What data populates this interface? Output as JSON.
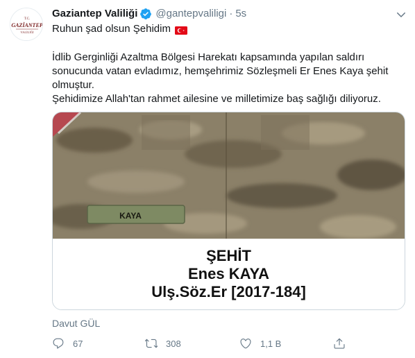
{
  "tweet": {
    "author": {
      "display_name": "Gaziantep Valiliği",
      "handle": "@gantepvaliligi",
      "verified": true,
      "avatar_text": "GAZİANTEP",
      "avatar_top_text": "T.C.",
      "avatar_bottom_text": "VALİLİĞİ"
    },
    "separator": "·",
    "time": "5s",
    "first_line": "Ruhun şad olsun Şehidim",
    "body_lines": [
      "İdlib Gerginliği Azaltma Bölgesi Harekatı kapsamında yapılan saldırı",
      "sonucunda vatan evladımız, hemşehrimiz Sözleşmeli Er Enes Kaya şehit",
      "olmuştur.",
      "Şehidimize Allah'tan rahmet ailesine ve milletimize baş sağlığı diliyoruz."
    ],
    "media": {
      "name_tape": "KAYA",
      "caption_line1": "ŞEHİT",
      "caption_line2": "Enes KAYA",
      "caption_line3": "Ulş.Söz.Er [2017-184]"
    },
    "attribution": "Davut GÜL",
    "actions": {
      "replies": "67",
      "retweets": "308",
      "likes": "1,1 B"
    }
  },
  "icons": {
    "verified": "verified-badge-icon",
    "caret": "chevron-down-icon",
    "flag": "turkey-flag-icon",
    "reply": "reply-icon",
    "retweet": "retweet-icon",
    "like": "heart-icon",
    "share": "share-icon"
  },
  "colors": {
    "text_primary": "#14171a",
    "text_secondary": "#657786",
    "verified_blue": "#1da1f2",
    "flag_red": "#e30a17",
    "camo_base": "#8a7f68"
  }
}
